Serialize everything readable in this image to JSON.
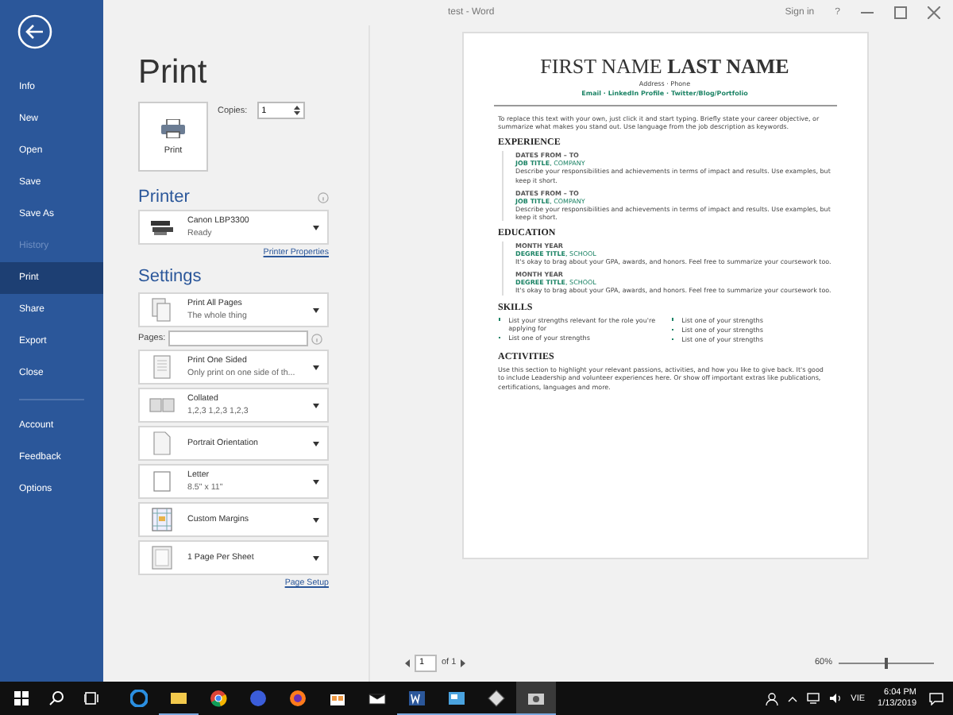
{
  "window": {
    "title": "test - Word",
    "sign_in": "Sign in",
    "help": "?"
  },
  "sidebar": {
    "items": [
      {
        "label": "Info",
        "selected": false,
        "disabled": false
      },
      {
        "label": "New",
        "selected": false,
        "disabled": false
      },
      {
        "label": "Open",
        "selected": false,
        "disabled": false
      },
      {
        "label": "Save",
        "selected": false,
        "disabled": false
      },
      {
        "label": "Save As",
        "selected": false,
        "disabled": false
      },
      {
        "label": "History",
        "selected": false,
        "disabled": true
      },
      {
        "label": "Print",
        "selected": true,
        "disabled": false
      },
      {
        "label": "Share",
        "selected": false,
        "disabled": false
      },
      {
        "label": "Export",
        "selected": false,
        "disabled": false
      },
      {
        "label": "Close",
        "selected": false,
        "disabled": false
      }
    ],
    "bottom_items": [
      {
        "label": "Account",
        "selected": false,
        "disabled": false
      },
      {
        "label": "Feedback",
        "selected": false,
        "disabled": false
      },
      {
        "label": "Options",
        "selected": false,
        "disabled": false
      }
    ]
  },
  "print": {
    "title": "Print",
    "button": "Print",
    "copies_label": "Copies:",
    "copies": "1"
  },
  "printer": {
    "heading": "Printer",
    "name": "Canon LBP3300",
    "status": "Ready",
    "properties_link": "Printer Properties"
  },
  "settings": {
    "heading": "Settings",
    "pages_label": "Pages:",
    "page_setup_link": "Page Setup",
    "items": [
      {
        "kind": "pages",
        "title": "Print All Pages",
        "subtitle": "The whole thing"
      },
      {
        "kind": "sides",
        "title": "Print One Sided",
        "subtitle": "Only print on one side of th..."
      },
      {
        "kind": "collate",
        "title": "Collated",
        "subtitle": "1,2,3    1,2,3    1,2,3"
      },
      {
        "kind": "orientation",
        "title": "Portrait Orientation"
      },
      {
        "kind": "paper",
        "title": "Letter",
        "subtitle": "8.5\" x 11\""
      },
      {
        "kind": "margins",
        "title": "Custom Margins"
      },
      {
        "kind": "sheet",
        "title": "1 Page Per Sheet"
      }
    ]
  },
  "preview": {
    "name": "FIRST NAME **LAST NAME**",
    "address": "Address · Phone",
    "links": "Email · LinkedIn Profile · Twitter/Blog/Portfolio",
    "objective": "To replace this text with your own, just click it and start typing. Briefly state your career objective, or summarize what makes you stand out. Use language from the job description as keywords.",
    "sections": [
      {
        "kind": "entries",
        "heading": "EXPERIENCE",
        "entries": [
          {
            "date": "DATES FROM – TO",
            "title": "**JOB TITLE**, COMPANY",
            "text": "Describe your responsibilities and achievements in terms of impact and results. Use examples, but keep it short."
          },
          {
            "date": "DATES FROM – TO",
            "title": "**JOB TITLE**, COMPANY",
            "text": "Describe your responsibilities and achievements in terms of impact and results. Use examples, but keep it short."
          }
        ]
      },
      {
        "kind": "entries",
        "heading": "EDUCATION",
        "entries": [
          {
            "date": "MONTH YEAR",
            "title": "**DEGREE TITLE**, SCHOOL",
            "text": "It's okay to brag about your GPA, awards, and honors. Feel free to summarize your coursework too."
          },
          {
            "date": "MONTH YEAR",
            "title": "**DEGREE TITLE**, SCHOOL",
            "text": "It's okay to brag about your GPA, awards, and honors. Feel free to summarize your coursework too."
          }
        ]
      },
      {
        "kind": "bullets",
        "heading": "SKILLS",
        "columns": [
          [
            "List your strengths relevant for the role you're applying for",
            "List one of your strengths"
          ],
          [
            "List one of your strengths",
            "List one of your strengths",
            "List one of your strengths"
          ]
        ]
      },
      {
        "kind": "paragraph",
        "heading": "ACTIVITIES",
        "text": "Use this section to highlight your relevant passions, activities, and how you like to give back. It's good to include Leadership and volunteer experiences here. Or show off important extras like publications, certifications, languages and more."
      }
    ],
    "page": "1",
    "of": "of 1",
    "zoom": "60%",
    "zoom_slider": {
      "level": 0.5
    }
  },
  "taskbar": {
    "apps": [
      {
        "kind": "edge",
        "running": false,
        "selected": false
      },
      {
        "kind": "folder",
        "running": true,
        "selected": false
      },
      {
        "kind": "chrome",
        "running": false,
        "selected": false
      },
      {
        "kind": "firefox-dev",
        "running": false,
        "selected": false
      },
      {
        "kind": "firefox",
        "running": false,
        "selected": false
      },
      {
        "kind": "store",
        "running": false,
        "selected": false
      },
      {
        "kind": "mail",
        "running": false,
        "selected": false
      },
      {
        "kind": "word",
        "running": true,
        "selected": false
      },
      {
        "kind": "remote",
        "running": true,
        "selected": false
      },
      {
        "kind": "snip",
        "running": true,
        "selected": false
      },
      {
        "kind": "camera",
        "running": true,
        "selected": true
      }
    ],
    "language": "VIE",
    "time": "6:04 PM",
    "date": "1/13/2019"
  }
}
